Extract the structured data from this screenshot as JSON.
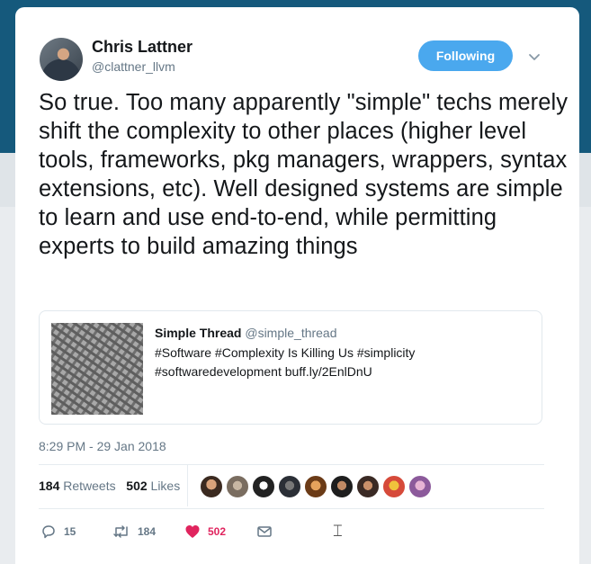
{
  "author": {
    "name": "Chris Lattner",
    "handle": "@clattner_llvm",
    "follow_label": "Following"
  },
  "tweet": {
    "text": "So true. Too many apparently \"simple\" techs merely shift the complexity to other places (higher level tools, frameworks, pkg managers, wrappers, syntax extensions, etc). Well designed systems are simple to learn and use end-to-end, while permitting experts to build amazing things",
    "timestamp": "8:29 PM - 29 Jan 2018"
  },
  "quote": {
    "author_name": "Simple Thread",
    "author_handle": "@simple_thread",
    "line1": "#Software #Complexity Is Killing Us #simplicity",
    "line2": "#softwaredevelopment buff.ly/2EnlDnU"
  },
  "stats": {
    "retweets_count": "184",
    "retweets_label": "Retweets",
    "likes_count": "502",
    "likes_label": "Likes"
  },
  "likers": [
    "liker-1",
    "liker-2",
    "liker-3",
    "liker-4",
    "liker-5",
    "liker-6",
    "liker-7",
    "liker-8",
    "liker-9"
  ],
  "actions": {
    "replies": "15",
    "retweets": "184",
    "likes": "502"
  },
  "colors": {
    "accent": "#4aa8ee",
    "like": "#e0245e",
    "secondary_text": "#657786"
  },
  "icons": [
    "chevron-down-icon",
    "reply-icon",
    "retweet-icon",
    "heart-icon",
    "message-icon",
    "text-cursor-icon"
  ]
}
